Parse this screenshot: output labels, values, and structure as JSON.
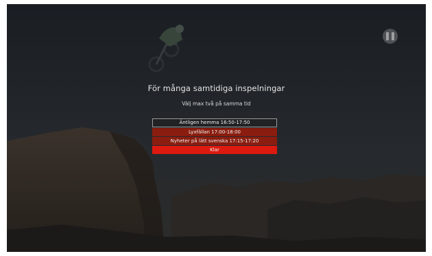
{
  "dialog": {
    "title": "För många samtidiga inspelningar",
    "subtitle": "Välj max två på samma tid",
    "programs": [
      {
        "label": "Äntligen hemma 16:50-17:50",
        "state": "unselected"
      },
      {
        "label": "Lyxfällan 17:00-18:00",
        "state": "selected"
      },
      {
        "label": "Nyheter på lätt svenska 17:15-17:20",
        "state": "selected"
      }
    ],
    "confirm_label": "Klar"
  },
  "player": {
    "control_icon": "pause-icon"
  },
  "colors": {
    "selected": "#8a1d0f",
    "confirm": "#dc1a10",
    "unselected_border": "#9a9a9a"
  }
}
